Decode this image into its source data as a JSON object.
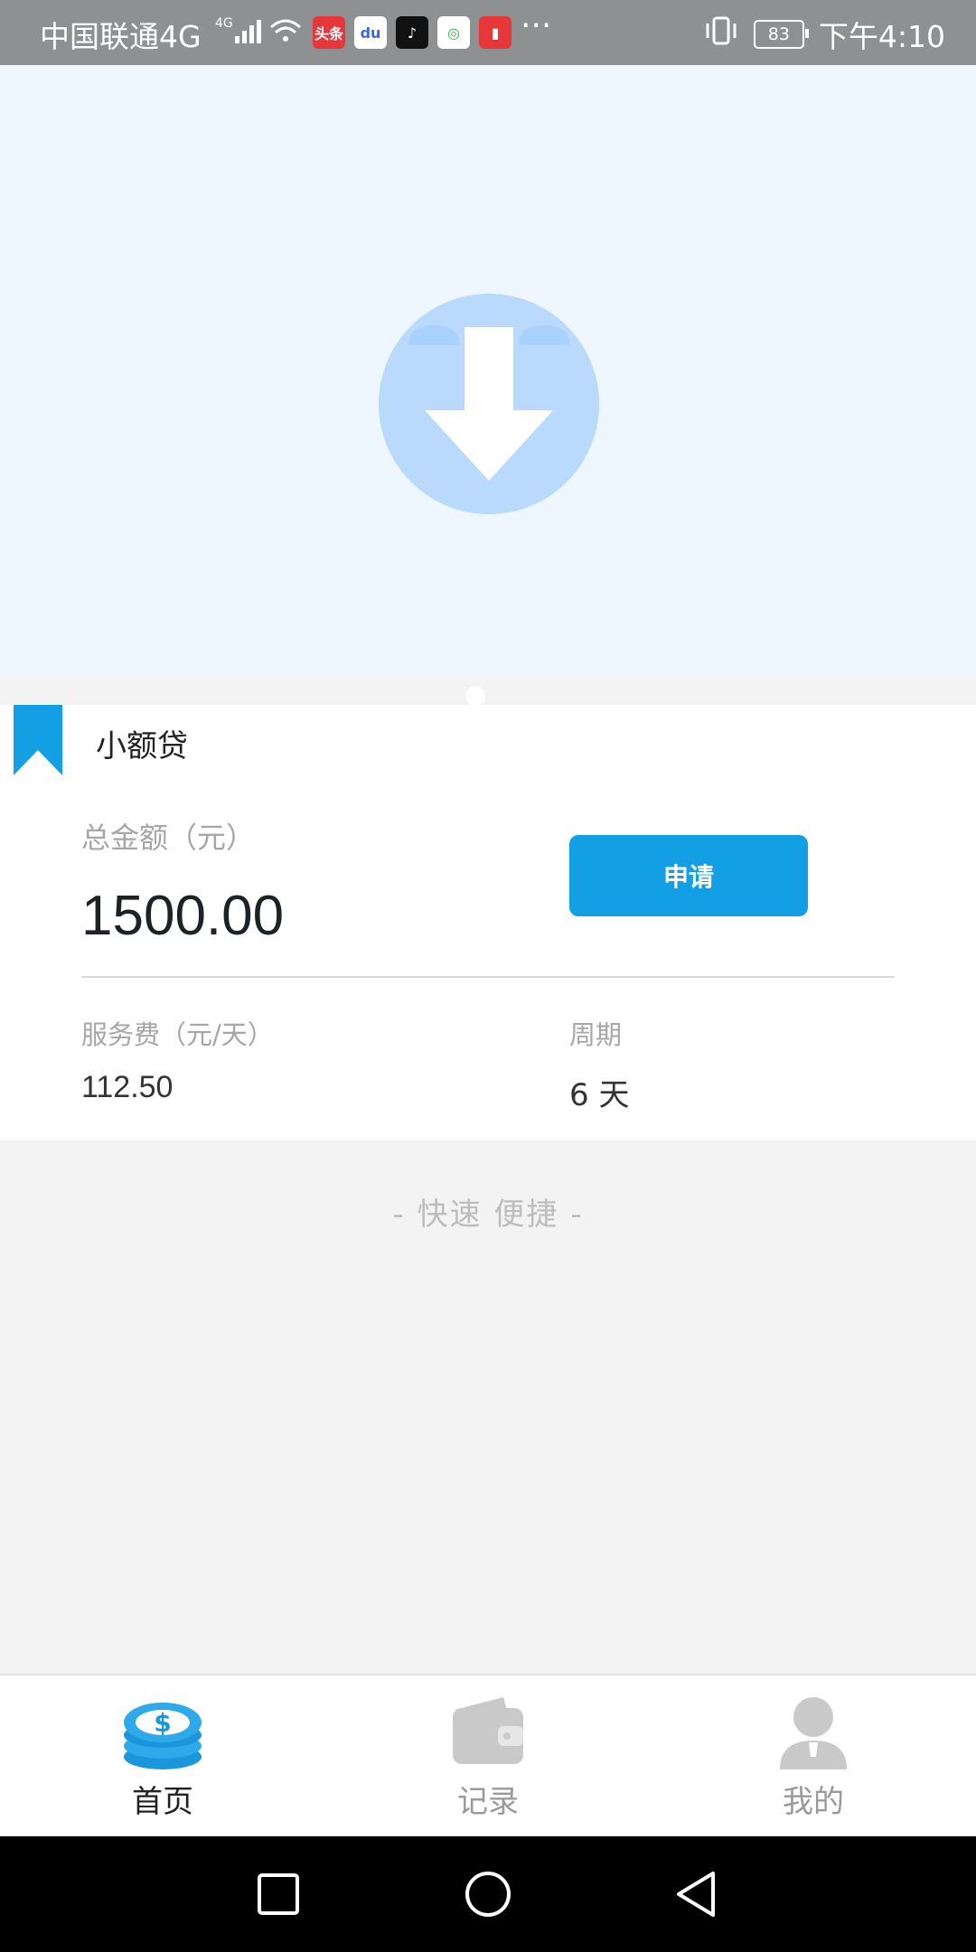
{
  "status_bar": {
    "carrier": "中国联通4G",
    "network": "4G",
    "notifications": [
      {
        "icon": "toutiao-icon",
        "text": "头条",
        "color": "#e8373b"
      },
      {
        "icon": "baidu-icon",
        "text": "du",
        "color": "#3a64e0"
      },
      {
        "icon": "douyin-icon",
        "text": "♪",
        "color": "#111111"
      },
      {
        "icon": "browser-icon",
        "text": "◎",
        "color": "#3bb34a"
      },
      {
        "icon": "reader-icon",
        "text": "▮",
        "color": "#e8373b"
      }
    ],
    "more": "···",
    "battery": "83",
    "time": "下午4:10"
  },
  "banner": {
    "image_icon": "download-arrow-icon",
    "page_indicator_count": 1
  },
  "loan_card": {
    "title": "小额贷",
    "amount_label": "总金额（元）",
    "amount_value": "1500.00",
    "apply_button": "申请",
    "fee_label": "服务费（元/天）",
    "fee_value": "112.50",
    "period_label": "周期",
    "period_value": "6 天",
    "accent_color": "#139fe3"
  },
  "slogan": "- 快速 便捷 -",
  "tabs": [
    {
      "label": "首页",
      "icon": "coin-stack-icon",
      "active": true
    },
    {
      "label": "记录",
      "icon": "wallet-icon",
      "active": false
    },
    {
      "label": "我的",
      "icon": "user-icon",
      "active": false
    }
  ],
  "nav_bar": {
    "buttons": [
      "recent-apps-icon",
      "home-icon",
      "back-icon"
    ]
  }
}
